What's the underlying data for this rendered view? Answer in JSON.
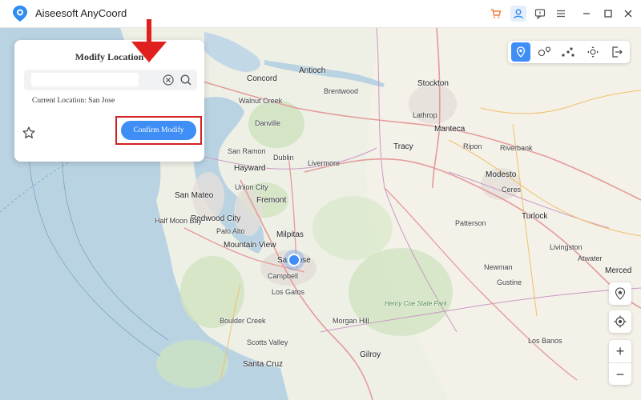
{
  "app": {
    "title": "Aiseesoft AnyCoord",
    "accent": "#3f8ef5",
    "titlebar_icons": [
      "cart-icon",
      "user-icon",
      "feedback-icon",
      "menu-icon",
      "minimize-icon",
      "maximize-icon",
      "close-icon"
    ]
  },
  "panel": {
    "title": "Modify Location",
    "search_value": "",
    "current_location": "Current Location: San Jose",
    "confirm_label": "Confirm Modify"
  },
  "mode_toolbar": {
    "modes": [
      "modify-location-icon",
      "one-stop-mode-icon",
      "multi-stop-mode-icon",
      "joystick-mode-icon",
      "exit-icon"
    ],
    "active": "modify-location-icon"
  },
  "map_controls": {
    "zoom_in": "+",
    "zoom_out": "−"
  },
  "map": {
    "labels": {
      "concord": "Concord",
      "antioch": "Antioch",
      "walnut_creek": "Walnut Creek",
      "danville": "Danville",
      "san_ramon": "San Ramon",
      "dublin": "Dublin",
      "livermore": "Livermore",
      "hayward": "Hayward",
      "union_city": "Union City",
      "fremont": "Fremont",
      "san_mateo": "San Mateo",
      "redwood_city": "Redwood City",
      "half_moon_bay": "Half Moon Bay",
      "palo_alto": "Palo Alto",
      "mountain_view": "Mountain View",
      "milpitas": "Milpitas",
      "san_jose": "San Jose",
      "campbell": "Campbell",
      "los_gatos": "Los Gatos",
      "boulder_creek": "Boulder Creek",
      "scotts_valley": "Scotts Valley",
      "santa_cruz": "Santa Cruz",
      "morgan_hill": "Morgan Hill",
      "gilroy": "Gilroy",
      "henry_coe": "Henry Coe State Park",
      "stockton": "Stockton",
      "manteca": "Manteca",
      "tracy": "Tracy",
      "ripon": "Ripon",
      "riverbank": "Riverbank",
      "modesto": "Modesto",
      "ceres": "Ceres",
      "patterson": "Patterson",
      "turlock": "Turlock",
      "livingston": "Livingston",
      "atwater": "Atwater",
      "newman": "Newman",
      "gustine": "Gustine",
      "los_banos": "Los Banos",
      "merced": "Merced",
      "brentwood": "Brentwood",
      "lathrop": "Lathrop"
    }
  }
}
